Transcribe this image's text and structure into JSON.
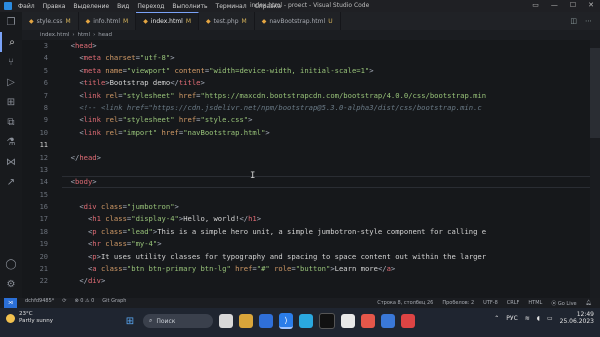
{
  "titlebar": {
    "menus": [
      "Файл",
      "Правка",
      "Выделение",
      "Вид",
      "Переход",
      "Выполнить",
      "Терминал",
      "Справка"
    ],
    "title": "index.html - proect - Visual Studio Code"
  },
  "tabs": [
    {
      "label": "style.css",
      "mark": "M",
      "active": false
    },
    {
      "label": "info.html",
      "mark": "M",
      "active": false
    },
    {
      "label": "index.html",
      "mark": "M",
      "active": true
    },
    {
      "label": "test.php",
      "mark": "M",
      "active": false
    },
    {
      "label": "navBootstrap.html",
      "mark": "U",
      "active": false
    }
  ],
  "breadcrumb": [
    "index.html",
    "html",
    "head"
  ],
  "editor": {
    "line_numbers": [
      "3",
      "4",
      "5",
      "6",
      "7",
      "8",
      "9",
      "10",
      "11",
      "12",
      "13",
      "14",
      "15",
      "16",
      "17",
      "18",
      "19",
      "20",
      "21",
      "22"
    ],
    "current_line": "11",
    "lines": [
      [
        "  ",
        "<head>"
      ],
      [
        "    ",
        "<meta charset=\"utf-8\">"
      ],
      [
        "    ",
        "<meta name=\"viewport\" content=\"width=device-width, initial-scale=1\">"
      ],
      [
        "    ",
        "<title>Bootstrap demo</title>"
      ],
      [
        "    ",
        "<link rel=\"stylesheet\" href=\"https://maxcdn.bootstrapcdn.com/bootstrap/4.0.0/css/bootstrap.min"
      ],
      [
        "    ",
        "<!-- <link href=\"https://cdn.jsdelivr.net/npm/bootstrap@5.3.0-alpha3/dist/css/bootstrap.min.c"
      ],
      [
        "    ",
        "<link rel=\"stylesheet\" href=\"style.css\">"
      ],
      [
        "    ",
        "<link rel=\"import\" href=\"navBootstrap.html\">"
      ],
      [
        "",
        ""
      ],
      [
        "  ",
        "</head>"
      ],
      [
        "",
        ""
      ],
      [
        "  ",
        "<body>"
      ],
      [
        "",
        ""
      ],
      [
        "    ",
        "<div class=\"jumbotron\">"
      ],
      [
        "      ",
        "<h1 class=\"display-4\">Hello, world!</h1>"
      ],
      [
        "      ",
        "<p class=\"lead\">This is a simple hero unit, a simple jumbotron-style component for calling e"
      ],
      [
        "      ",
        "<hr class=\"my-4\">"
      ],
      [
        "      ",
        "<p>It uses utility classes for typography and spacing to space content out within the larger"
      ],
      [
        "      ",
        "<a class=\"btn btn-primary btn-lg\" href=\"#\" role=\"button\">Learn more</a>"
      ],
      [
        "    ",
        "</div>"
      ]
    ]
  },
  "statusbar": {
    "branch": "dchfd9485*",
    "sync": "⟳",
    "problems": "⊗ 0 ⚠ 0",
    "git_graph": "Git Graph",
    "position": "Строка 8, столбец 26",
    "spaces": "Пробелов: 2",
    "encoding": "UTF-8",
    "eol": "CRLF",
    "language": "HTML",
    "golive": "⦿ Go Live"
  },
  "taskbar": {
    "temp": "23°C",
    "weather": "Partly sunny",
    "search_placeholder": "Поиск",
    "lang": "РУС",
    "time": "12:49",
    "date": "25.06.2023"
  },
  "colors": {
    "tag": "#e06c75",
    "attr": "#d19a66",
    "string": "#98c379",
    "comment": "#6a7a86",
    "accent": "#7aa2f7"
  }
}
